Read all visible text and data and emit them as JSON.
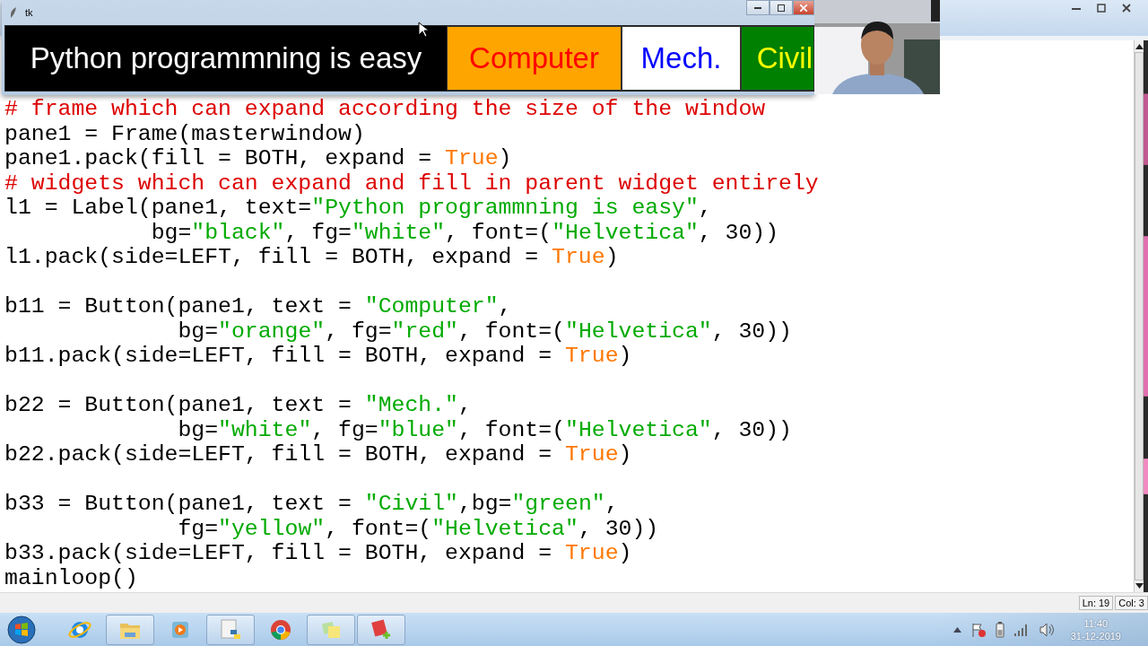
{
  "tk_window": {
    "title": "tk",
    "widgets": [
      {
        "kind": "label",
        "text": "Python programmning is easy",
        "color": "#000000"
      },
      {
        "kind": "button",
        "text": "Computer",
        "color": "#ffa500"
      },
      {
        "kind": "button",
        "text": "Mech.",
        "color": "#ffffff"
      },
      {
        "kind": "button",
        "text": "Civil",
        "color": "#008000"
      }
    ]
  },
  "editor": {
    "lines": [
      {
        "kind": "code",
        "tokens": [
          {
            "kind": "comment",
            "text": "# frame which can expand according the size of the window"
          }
        ]
      },
      {
        "kind": "code",
        "tokens": [
          {
            "kind": "plain",
            "text": "pane1 = Frame(masterwindow)"
          }
        ]
      },
      {
        "kind": "code",
        "tokens": [
          {
            "kind": "plain",
            "text": "pane1.pack(fill = BOTH, expand = "
          },
          {
            "kind": "keyword",
            "text": "True"
          },
          {
            "kind": "plain",
            "text": ")"
          }
        ]
      },
      {
        "kind": "code",
        "tokens": [
          {
            "kind": "comment",
            "text": "# widgets which can expand and fill in parent widget entirely"
          }
        ]
      },
      {
        "kind": "code",
        "tokens": [
          {
            "kind": "plain",
            "text": "l1 = Label(pane1, text="
          },
          {
            "kind": "string",
            "text": "\"Python programmning is easy\""
          },
          {
            "kind": "plain",
            "text": ","
          }
        ]
      },
      {
        "kind": "code",
        "tokens": [
          {
            "kind": "plain",
            "text": "           bg="
          },
          {
            "kind": "string",
            "text": "\"black\""
          },
          {
            "kind": "plain",
            "text": ", fg="
          },
          {
            "kind": "string",
            "text": "\"white\""
          },
          {
            "kind": "plain",
            "text": ", font=("
          },
          {
            "kind": "string",
            "text": "\"Helvetica\""
          },
          {
            "kind": "plain",
            "text": ", 30))"
          }
        ]
      },
      {
        "kind": "code",
        "tokens": [
          {
            "kind": "plain",
            "text": "l1.pack(side=LEFT, fill = BOTH, expand = "
          },
          {
            "kind": "keyword",
            "text": "True"
          },
          {
            "kind": "plain",
            "text": ")"
          }
        ]
      },
      {
        "kind": "blank"
      },
      {
        "kind": "code",
        "tokens": [
          {
            "kind": "plain",
            "text": "b11 = Button(pane1, text = "
          },
          {
            "kind": "string",
            "text": "\"Computer\""
          },
          {
            "kind": "plain",
            "text": ","
          }
        ]
      },
      {
        "kind": "code",
        "tokens": [
          {
            "kind": "plain",
            "text": "             bg="
          },
          {
            "kind": "string",
            "text": "\"orange\""
          },
          {
            "kind": "plain",
            "text": ", fg="
          },
          {
            "kind": "string",
            "text": "\"red\""
          },
          {
            "kind": "plain",
            "text": ", font=("
          },
          {
            "kind": "string",
            "text": "\"Helvetica\""
          },
          {
            "kind": "plain",
            "text": ", 30))"
          }
        ]
      },
      {
        "kind": "code",
        "tokens": [
          {
            "kind": "plain",
            "text": "b11.pack(side=LEFT, fill = BOTH, expand = "
          },
          {
            "kind": "keyword",
            "text": "True"
          },
          {
            "kind": "plain",
            "text": ")"
          }
        ]
      },
      {
        "kind": "blank"
      },
      {
        "kind": "code",
        "tokens": [
          {
            "kind": "plain",
            "text": "b22 = Button(pane1, text = "
          },
          {
            "kind": "string",
            "text": "\"Mech.\""
          },
          {
            "kind": "plain",
            "text": ","
          }
        ]
      },
      {
        "kind": "code",
        "tokens": [
          {
            "kind": "plain",
            "text": "             bg="
          },
          {
            "kind": "string",
            "text": "\"white\""
          },
          {
            "kind": "plain",
            "text": ", fg="
          },
          {
            "kind": "string",
            "text": "\"blue\""
          },
          {
            "kind": "plain",
            "text": ", font=("
          },
          {
            "kind": "string",
            "text": "\"Helvetica\""
          },
          {
            "kind": "plain",
            "text": ", 30))"
          }
        ]
      },
      {
        "kind": "code",
        "tokens": [
          {
            "kind": "plain",
            "text": "b22.pack(side=LEFT, fill = BOTH, expand = "
          },
          {
            "kind": "keyword",
            "text": "True"
          },
          {
            "kind": "plain",
            "text": ")"
          }
        ]
      },
      {
        "kind": "blank"
      },
      {
        "kind": "code",
        "tokens": [
          {
            "kind": "plain",
            "text": "b33 = Button(pane1, text = "
          },
          {
            "kind": "string",
            "text": "\"Civil\""
          },
          {
            "kind": "plain",
            "text": ",bg="
          },
          {
            "kind": "string",
            "text": "\"green\""
          },
          {
            "kind": "plain",
            "text": ","
          }
        ]
      },
      {
        "kind": "code",
        "tokens": [
          {
            "kind": "plain",
            "text": "             fg="
          },
          {
            "kind": "string",
            "text": "\"yellow\""
          },
          {
            "kind": "plain",
            "text": ", font=("
          },
          {
            "kind": "string",
            "text": "\"Helvetica\""
          },
          {
            "kind": "plain",
            "text": ", 30))"
          }
        ]
      },
      {
        "kind": "code",
        "tokens": [
          {
            "kind": "plain",
            "text": "b33.pack(side=LEFT, fill = BOTH, expand = "
          },
          {
            "kind": "keyword",
            "text": "True"
          },
          {
            "kind": "plain",
            "text": ")"
          }
        ]
      },
      {
        "kind": "code",
        "tokens": [
          {
            "kind": "plain",
            "text": "mainloop()"
          }
        ]
      }
    ]
  },
  "status_bar": {
    "line": "Ln: 19",
    "column": "Col: 3"
  },
  "taskbar": {
    "items": [
      {
        "kind": "ie",
        "open": false
      },
      {
        "kind": "folder",
        "open": true
      },
      {
        "kind": "media",
        "open": false
      },
      {
        "kind": "python",
        "open": true
      },
      {
        "kind": "chrome",
        "open": false
      },
      {
        "kind": "sticky",
        "open": true
      },
      {
        "kind": "app",
        "open": true
      }
    ],
    "time": "11:40",
    "date": "31-12-2019"
  }
}
